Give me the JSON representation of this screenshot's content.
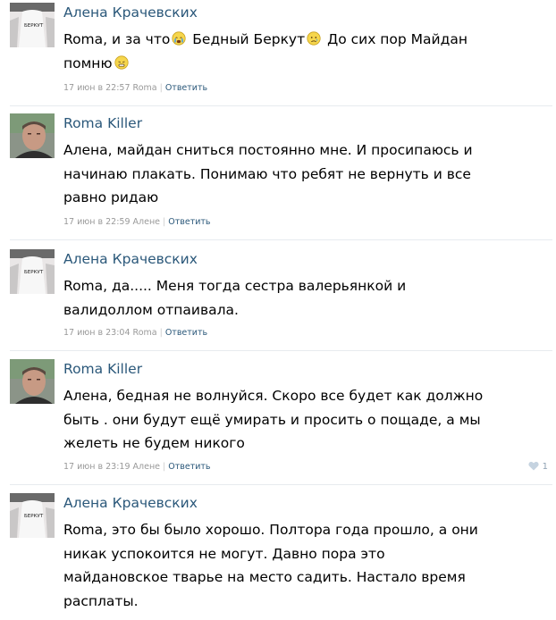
{
  "comments": [
    {
      "author": "Алена Крачевских",
      "text_parts": [
        "Roma, и за что",
        "Бедный Беркут",
        "До сих пор Майдан помню"
      ],
      "date": "17 июн в 22:57",
      "reply_to": "Roma",
      "reply_label": "Ответить",
      "avatar_shirt_text": "БЕРКУТ"
    },
    {
      "author": "Roma Killer",
      "text": "Алена, майдан сниться постоянно мне. И просипаюсь и начинаю плакать. Понимаю что ребят не вернуть и все равно ридаю",
      "date": "17 июн в 22:59",
      "reply_to": "Алене",
      "reply_label": "Ответить"
    },
    {
      "author": "Алена Крачевских",
      "text": "Roma, да..... Меня тогда сестра валерьянкой и валидоллом отпаивала.",
      "date": "17 июн в 23:04",
      "reply_to": "Roma",
      "reply_label": "Ответить",
      "avatar_shirt_text": "БЕРКУТ"
    },
    {
      "author": "Roma Killer",
      "text": "Алена, бедная не волнуйся. Скоро все будет как должно быть . они будут ещё умирать и просить о пощаде, а мы желеть не будем никого",
      "date": "17 июн в 23:19",
      "reply_to": "Алене",
      "reply_label": "Ответить",
      "likes": "1"
    },
    {
      "author": "Алена Крачевских",
      "text": "Roma, это бы было хорошо. Полтора года прошло, а они никак успокоится не могут. Давно пора это майдановское тварье на место садить. Настало время расплаты.",
      "avatar_shirt_text": "БЕРКУТ"
    }
  ]
}
